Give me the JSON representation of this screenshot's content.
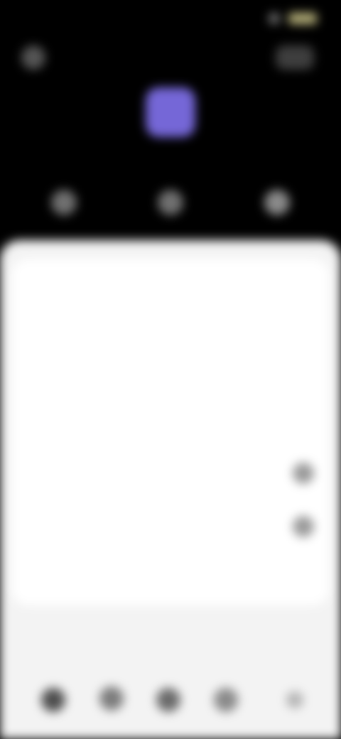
{
  "status": {
    "time": "",
    "battery": ""
  },
  "app": {
    "title": "",
    "icon_color": "#7567d7"
  },
  "quick_actions": [
    "share-icon",
    "edit-icon",
    "settings-icon"
  ],
  "list": {
    "items": [
      {
        "label": "",
        "sub": ""
      },
      {
        "label": "",
        "sub": ""
      },
      {
        "label": "",
        "sub": ""
      },
      {
        "label": "",
        "sub": "",
        "toggle": true
      },
      {
        "label": "",
        "sub": "",
        "toggle": true
      },
      {
        "label": "",
        "sub": ""
      }
    ]
  },
  "bottom_nav": {
    "items": [
      "home-icon",
      "search-icon",
      "apps-icon",
      "profile-icon",
      "more-icon"
    ]
  }
}
